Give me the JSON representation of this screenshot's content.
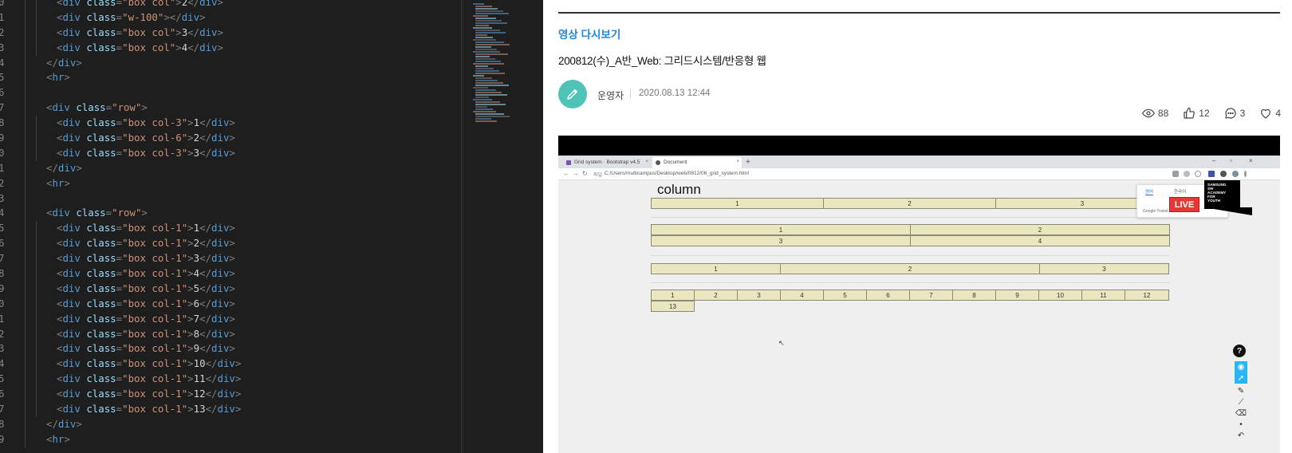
{
  "editor": {
    "lines": [
      {
        "num": "0",
        "indent": 2,
        "html_parts": [
          [
            "br",
            "<"
          ],
          [
            "tag",
            "div"
          ],
          [
            "sp",
            " "
          ],
          [
            "attr",
            "class"
          ],
          [
            "br",
            "="
          ],
          [
            "str",
            "\"box col\""
          ],
          [
            "br",
            ">"
          ],
          [
            "txt",
            "2"
          ],
          [
            "br",
            "</"
          ],
          [
            "tag",
            "div"
          ],
          [
            "br",
            ">"
          ]
        ]
      },
      {
        "num": "1",
        "indent": 2,
        "html_parts": [
          [
            "br",
            "<"
          ],
          [
            "tag",
            "div"
          ],
          [
            "sp",
            " "
          ],
          [
            "attr",
            "class"
          ],
          [
            "br",
            "="
          ],
          [
            "str",
            "\"w-100\""
          ],
          [
            "br",
            "></"
          ],
          [
            "tag",
            "div"
          ],
          [
            "br",
            ">"
          ]
        ]
      },
      {
        "num": "2",
        "indent": 2,
        "html_parts": [
          [
            "br",
            "<"
          ],
          [
            "tag",
            "div"
          ],
          [
            "sp",
            " "
          ],
          [
            "attr",
            "class"
          ],
          [
            "br",
            "="
          ],
          [
            "str",
            "\"box col\""
          ],
          [
            "br",
            ">"
          ],
          [
            "txt",
            "3"
          ],
          [
            "br",
            "</"
          ],
          [
            "tag",
            "div"
          ],
          [
            "br",
            ">"
          ]
        ]
      },
      {
        "num": "3",
        "indent": 2,
        "html_parts": [
          [
            "br",
            "<"
          ],
          [
            "tag",
            "div"
          ],
          [
            "sp",
            " "
          ],
          [
            "attr",
            "class"
          ],
          [
            "br",
            "="
          ],
          [
            "str",
            "\"box col\""
          ],
          [
            "br",
            ">"
          ],
          [
            "txt",
            "4"
          ],
          [
            "br",
            "</"
          ],
          [
            "tag",
            "div"
          ],
          [
            "br",
            ">"
          ]
        ]
      },
      {
        "num": "4",
        "indent": 1,
        "html_parts": [
          [
            "br",
            "</"
          ],
          [
            "tag",
            "div"
          ],
          [
            "br",
            ">"
          ]
        ]
      },
      {
        "num": "5",
        "indent": 1,
        "html_parts": [
          [
            "br",
            "<"
          ],
          [
            "tag",
            "hr"
          ],
          [
            "br",
            ">"
          ]
        ]
      },
      {
        "num": "6",
        "indent": 0,
        "html_parts": []
      },
      {
        "num": "7",
        "indent": 1,
        "html_parts": [
          [
            "br",
            "<"
          ],
          [
            "tag",
            "div"
          ],
          [
            "sp",
            " "
          ],
          [
            "attr",
            "class"
          ],
          [
            "br",
            "="
          ],
          [
            "str",
            "\"row\""
          ],
          [
            "br",
            ">"
          ]
        ]
      },
      {
        "num": "8",
        "indent": 2,
        "html_parts": [
          [
            "br",
            "<"
          ],
          [
            "tag",
            "div"
          ],
          [
            "sp",
            " "
          ],
          [
            "attr",
            "class"
          ],
          [
            "br",
            "="
          ],
          [
            "str",
            "\"box col-3\""
          ],
          [
            "br",
            ">"
          ],
          [
            "txt",
            "1"
          ],
          [
            "br",
            "</"
          ],
          [
            "tag",
            "div"
          ],
          [
            "br",
            ">"
          ]
        ]
      },
      {
        "num": "9",
        "indent": 2,
        "html_parts": [
          [
            "br",
            "<"
          ],
          [
            "tag",
            "div"
          ],
          [
            "sp",
            " "
          ],
          [
            "attr",
            "class"
          ],
          [
            "br",
            "="
          ],
          [
            "str",
            "\"box col-6\""
          ],
          [
            "br",
            ">"
          ],
          [
            "txt",
            "2"
          ],
          [
            "br",
            "</"
          ],
          [
            "tag",
            "div"
          ],
          [
            "br",
            ">"
          ]
        ]
      },
      {
        "num": "0",
        "indent": 2,
        "html_parts": [
          [
            "br",
            "<"
          ],
          [
            "tag",
            "div"
          ],
          [
            "sp",
            " "
          ],
          [
            "attr",
            "class"
          ],
          [
            "br",
            "="
          ],
          [
            "str",
            "\"box col-3\""
          ],
          [
            "br",
            ">"
          ],
          [
            "txt",
            "3"
          ],
          [
            "br",
            "</"
          ],
          [
            "tag",
            "div"
          ],
          [
            "br",
            ">"
          ]
        ]
      },
      {
        "num": "1",
        "indent": 1,
        "html_parts": [
          [
            "br",
            "</"
          ],
          [
            "tag",
            "div"
          ],
          [
            "br",
            ">"
          ]
        ]
      },
      {
        "num": "2",
        "indent": 1,
        "html_parts": [
          [
            "br",
            "<"
          ],
          [
            "tag",
            "hr"
          ],
          [
            "br",
            ">"
          ]
        ]
      },
      {
        "num": "3",
        "indent": 0,
        "html_parts": []
      },
      {
        "num": "4",
        "indent": 1,
        "html_parts": [
          [
            "br",
            "<"
          ],
          [
            "tag",
            "div"
          ],
          [
            "sp",
            " "
          ],
          [
            "attr",
            "class"
          ],
          [
            "br",
            "="
          ],
          [
            "str",
            "\"row\""
          ],
          [
            "br",
            ">"
          ]
        ]
      },
      {
        "num": "5",
        "indent": 2,
        "html_parts": [
          [
            "br",
            "<"
          ],
          [
            "tag",
            "div"
          ],
          [
            "sp",
            " "
          ],
          [
            "attr",
            "class"
          ],
          [
            "br",
            "="
          ],
          [
            "str",
            "\"box col-1\""
          ],
          [
            "br",
            ">"
          ],
          [
            "txt",
            "1"
          ],
          [
            "br",
            "</"
          ],
          [
            "tag",
            "div"
          ],
          [
            "br",
            ">"
          ]
        ]
      },
      {
        "num": "6",
        "indent": 2,
        "html_parts": [
          [
            "br",
            "<"
          ],
          [
            "tag",
            "div"
          ],
          [
            "sp",
            " "
          ],
          [
            "attr",
            "class"
          ],
          [
            "br",
            "="
          ],
          [
            "str",
            "\"box col-1\""
          ],
          [
            "br",
            ">"
          ],
          [
            "txt",
            "2"
          ],
          [
            "br",
            "</"
          ],
          [
            "tag",
            "div"
          ],
          [
            "br",
            ">"
          ]
        ]
      },
      {
        "num": "7",
        "indent": 2,
        "html_parts": [
          [
            "br",
            "<"
          ],
          [
            "tag",
            "div"
          ],
          [
            "sp",
            " "
          ],
          [
            "attr",
            "class"
          ],
          [
            "br",
            "="
          ],
          [
            "str",
            "\"box col-1\""
          ],
          [
            "br",
            ">"
          ],
          [
            "txt",
            "3"
          ],
          [
            "br",
            "</"
          ],
          [
            "tag",
            "div"
          ],
          [
            "br",
            ">"
          ]
        ]
      },
      {
        "num": "8",
        "indent": 2,
        "html_parts": [
          [
            "br",
            "<"
          ],
          [
            "tag",
            "div"
          ],
          [
            "sp",
            " "
          ],
          [
            "attr",
            "class"
          ],
          [
            "br",
            "="
          ],
          [
            "str",
            "\"box col-1\""
          ],
          [
            "br",
            ">"
          ],
          [
            "txt",
            "4"
          ],
          [
            "br",
            "</"
          ],
          [
            "tag",
            "div"
          ],
          [
            "br",
            ">"
          ]
        ]
      },
      {
        "num": "9",
        "indent": 2,
        "html_parts": [
          [
            "br",
            "<"
          ],
          [
            "tag",
            "div"
          ],
          [
            "sp",
            " "
          ],
          [
            "attr",
            "class"
          ],
          [
            "br",
            "="
          ],
          [
            "str",
            "\"box col-1\""
          ],
          [
            "br",
            ">"
          ],
          [
            "txt",
            "5"
          ],
          [
            "br",
            "</"
          ],
          [
            "tag",
            "div"
          ],
          [
            "br",
            ">"
          ]
        ]
      },
      {
        "num": "0",
        "indent": 2,
        "html_parts": [
          [
            "br",
            "<"
          ],
          [
            "tag",
            "div"
          ],
          [
            "sp",
            " "
          ],
          [
            "attr",
            "class"
          ],
          [
            "br",
            "="
          ],
          [
            "str",
            "\"box col-1\""
          ],
          [
            "br",
            ">"
          ],
          [
            "txt",
            "6"
          ],
          [
            "br",
            "</"
          ],
          [
            "tag",
            "div"
          ],
          [
            "br",
            ">"
          ]
        ]
      },
      {
        "num": "1",
        "indent": 2,
        "html_parts": [
          [
            "br",
            "<"
          ],
          [
            "tag",
            "div"
          ],
          [
            "sp",
            " "
          ],
          [
            "attr",
            "class"
          ],
          [
            "br",
            "="
          ],
          [
            "str",
            "\"box col-1\""
          ],
          [
            "br",
            ">"
          ],
          [
            "txt",
            "7"
          ],
          [
            "br",
            "</"
          ],
          [
            "tag",
            "div"
          ],
          [
            "br",
            ">"
          ]
        ]
      },
      {
        "num": "2",
        "indent": 2,
        "html_parts": [
          [
            "br",
            "<"
          ],
          [
            "tag",
            "div"
          ],
          [
            "sp",
            " "
          ],
          [
            "attr",
            "class"
          ],
          [
            "br",
            "="
          ],
          [
            "str",
            "\"box col-1\""
          ],
          [
            "br",
            ">"
          ],
          [
            "txt",
            "8"
          ],
          [
            "br",
            "</"
          ],
          [
            "tag",
            "div"
          ],
          [
            "br",
            ">"
          ]
        ]
      },
      {
        "num": "3",
        "indent": 2,
        "html_parts": [
          [
            "br",
            "<"
          ],
          [
            "tag",
            "div"
          ],
          [
            "sp",
            " "
          ],
          [
            "attr",
            "class"
          ],
          [
            "br",
            "="
          ],
          [
            "str",
            "\"box col-1\""
          ],
          [
            "br",
            ">"
          ],
          [
            "txt",
            "9"
          ],
          [
            "br",
            "</"
          ],
          [
            "tag",
            "div"
          ],
          [
            "br",
            ">"
          ]
        ]
      },
      {
        "num": "4",
        "indent": 2,
        "html_parts": [
          [
            "br",
            "<"
          ],
          [
            "tag",
            "div"
          ],
          [
            "sp",
            " "
          ],
          [
            "attr",
            "class"
          ],
          [
            "br",
            "="
          ],
          [
            "str",
            "\"box col-1\""
          ],
          [
            "br",
            ">"
          ],
          [
            "txt",
            "10"
          ],
          [
            "br",
            "</"
          ],
          [
            "tag",
            "div"
          ],
          [
            "br",
            ">"
          ]
        ]
      },
      {
        "num": "5",
        "indent": 2,
        "html_parts": [
          [
            "br",
            "<"
          ],
          [
            "tag",
            "div"
          ],
          [
            "sp",
            " "
          ],
          [
            "attr",
            "class"
          ],
          [
            "br",
            "="
          ],
          [
            "str",
            "\"box col-1\""
          ],
          [
            "br",
            ">"
          ],
          [
            "txt",
            "11"
          ],
          [
            "br",
            "</"
          ],
          [
            "tag",
            "div"
          ],
          [
            "br",
            ">"
          ]
        ]
      },
      {
        "num": "6",
        "indent": 2,
        "html_parts": [
          [
            "br",
            "<"
          ],
          [
            "tag",
            "div"
          ],
          [
            "sp",
            " "
          ],
          [
            "attr",
            "class"
          ],
          [
            "br",
            "="
          ],
          [
            "str",
            "\"box col-1\""
          ],
          [
            "br",
            ">"
          ],
          [
            "txt",
            "12"
          ],
          [
            "br",
            "</"
          ],
          [
            "tag",
            "div"
          ],
          [
            "br",
            ">"
          ]
        ]
      },
      {
        "num": "7",
        "indent": 2,
        "html_parts": [
          [
            "br",
            "<"
          ],
          [
            "tag",
            "div"
          ],
          [
            "sp",
            " "
          ],
          [
            "attr",
            "class"
          ],
          [
            "br",
            "="
          ],
          [
            "str",
            "\"box col-1\""
          ],
          [
            "br",
            ">"
          ],
          [
            "txt",
            "13"
          ],
          [
            "br",
            "</"
          ],
          [
            "tag",
            "div"
          ],
          [
            "br",
            ">"
          ]
        ]
      },
      {
        "num": "8",
        "indent": 1,
        "html_parts": [
          [
            "br",
            "</"
          ],
          [
            "tag",
            "div"
          ],
          [
            "br",
            ">"
          ]
        ]
      },
      {
        "num": "9",
        "indent": 1,
        "html_parts": [
          [
            "br",
            "<"
          ],
          [
            "tag",
            "hr"
          ],
          [
            "br",
            ">"
          ]
        ]
      }
    ]
  },
  "post": {
    "category": "영상 다시보기",
    "title": "200812(수)_A반_Web: 그리드시스템/반응형 웹",
    "author": "운영자",
    "separator": "|",
    "date": "2020.08.13 12:44",
    "views": "88",
    "likes": "12",
    "comments": "3",
    "hearts": "4"
  },
  "video": {
    "tabs": [
      {
        "label": "Grid system · Bootstrap v4.5",
        "close": "×",
        "fav_color": "#7952b3"
      },
      {
        "label": "Document",
        "close": "×",
        "fav_color": "#555555"
      }
    ],
    "new_tab": "+",
    "window_controls": [
      "–",
      "▫",
      "×"
    ],
    "secure_label": "파일",
    "url": "C:/Users/multicampus/Desktop/web/0812/06_grid_system.html",
    "page_heading": "column",
    "row1": [
      "1",
      "2",
      "3"
    ],
    "row2a": [
      "1",
      "2"
    ],
    "row2b": [
      "3",
      "4"
    ],
    "row3": [
      "1",
      "2",
      "3"
    ],
    "row4": [
      "1",
      "2",
      "3",
      "4",
      "5",
      "6",
      "7",
      "8",
      "9",
      "10",
      "11",
      "12"
    ],
    "row5": [
      "13"
    ],
    "translate_tabs": [
      "영어",
      "한국어"
    ],
    "translate_footer": "Google Transl...",
    "live_label": "LIVE",
    "academy_lines": [
      "SAMSUNG",
      "SW",
      "ACADEMY",
      "FOR",
      "YOUTH"
    ],
    "help_label": "?"
  },
  "colors": {
    "accent_blue": "#1e88e5",
    "avatar_teal": "#4fc3b7",
    "grid_cell": "#eae6c0",
    "live_red": "#e53935"
  }
}
